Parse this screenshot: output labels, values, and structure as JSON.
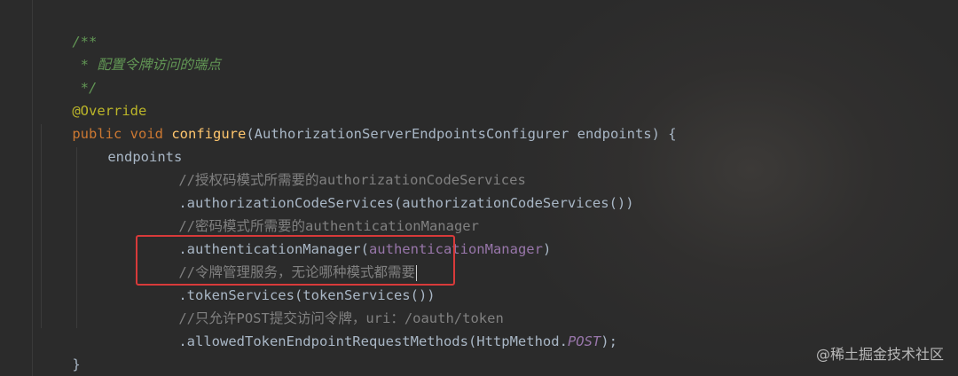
{
  "code": {
    "doc_open": "/**",
    "doc_comment": " * 配置令牌访问的端点",
    "doc_close": " */",
    "annotation": "@Override",
    "kw_public": "public",
    "kw_void": "void",
    "method_name": "configure",
    "params": "(AuthorizationServerEndpointsConfigurer endpoints) {",
    "endpoints": "endpoints",
    "comment_authcode": "//授权码模式所需要的authorizationCodeServices",
    "call_authcode": ".authorizationCodeServices(authorizationCodeServices())",
    "comment_password": "//密码模式所需要的authenticationManager",
    "call_authmgr_prefix": ".authenticationManager(",
    "call_authmgr_field": "authenticationManager",
    "call_authmgr_suffix": ")",
    "comment_token": "//令牌管理服务，无论哪种模式都需要",
    "call_token": ".tokenServices(tokenServices())",
    "comment_post": "//只允许POST提交访问令牌，uri：/oauth/token",
    "call_allowed_prefix": ".allowedTokenEndpointRequestMethods(HttpMethod.",
    "call_allowed_const": "POST",
    "call_allowed_suffix": ");",
    "close_brace": "}"
  },
  "watermark": "@稀土掘金技术社区",
  "colors": {
    "background": "#2b2b2b",
    "keyword": "#cc7832",
    "method": "#ffc66d",
    "annotation": "#bbb529",
    "doc_comment": "#629755",
    "comment": "#808080",
    "field": "#9876aa",
    "highlight_box": "#d83a3a"
  }
}
